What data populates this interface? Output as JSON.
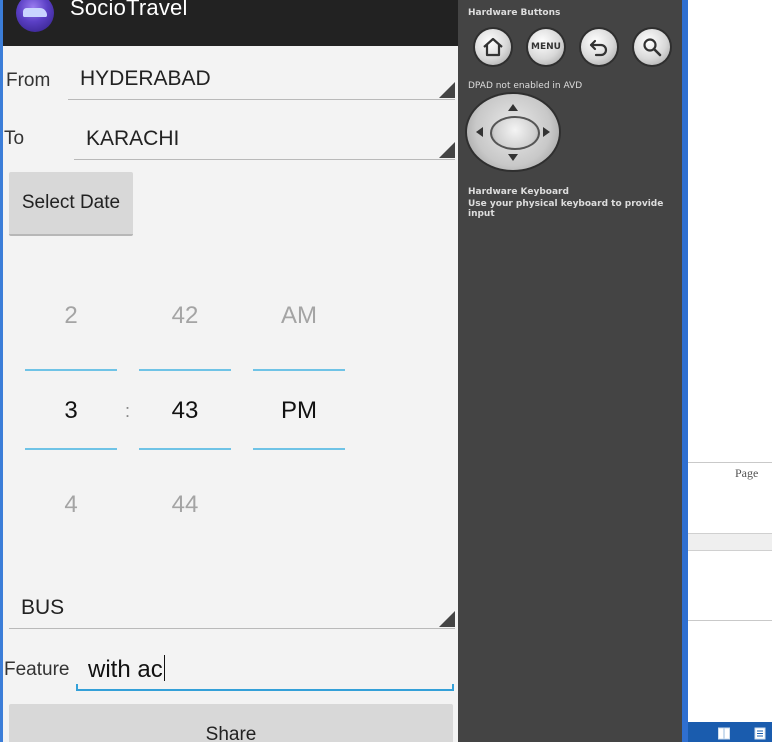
{
  "app": {
    "title": "SocioTravel",
    "from_label": "From",
    "from_value": "HYDERABAD",
    "to_label": "To",
    "to_value": "KARACHI",
    "select_date_label": "Select Date",
    "time_picker": {
      "hours": [
        "2",
        "3",
        "4"
      ],
      "minutes": [
        "42",
        "43",
        "44"
      ],
      "ampm": [
        "AM",
        "PM"
      ],
      "separator": ":"
    },
    "transport_value": "BUS",
    "feature_label": "Feature",
    "feature_value": "with ac",
    "share_label": "Share"
  },
  "emulator_panel": {
    "hardware_buttons_title": "Hardware Buttons",
    "buttons": [
      "home-icon",
      "MENU",
      "back-icon",
      "search-icon"
    ],
    "dpad_note": "DPAD not enabled in AVD",
    "keyboard_title": "Hardware Keyboard",
    "keyboard_note": "Use your physical keyboard to provide input"
  },
  "document_window": {
    "page_label": "Page"
  }
}
